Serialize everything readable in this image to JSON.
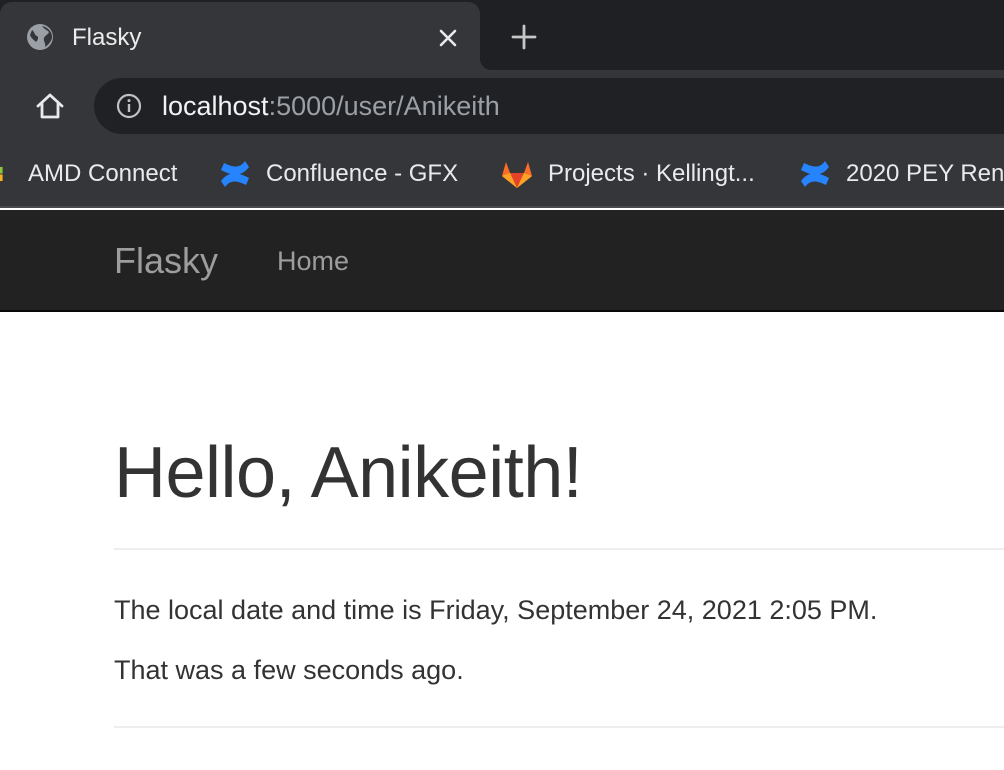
{
  "browser": {
    "tab": {
      "title": "Flasky",
      "favicon": "globe-icon",
      "close": "close-icon"
    },
    "new_tab": "plus-icon",
    "toolbar": {
      "home": "home-icon",
      "info": "info-icon"
    },
    "url": {
      "host": "localhost",
      "rest": ":5000/user/Anikeith"
    },
    "bookmarks": [
      {
        "label": "AMD Connect",
        "icon": "tiles-icon"
      },
      {
        "label": "Confluence - GFX",
        "icon": "confluence-icon"
      },
      {
        "label": "Projects · Kellingt...",
        "icon": "gitlab-icon"
      },
      {
        "label": "2020 PEY Ren",
        "icon": "confluence-icon"
      }
    ]
  },
  "navbar": {
    "brand": "Flasky",
    "links": [
      "Home"
    ]
  },
  "main": {
    "heading": "Hello, Anikeith!",
    "datetime_text": "The local date and time is Friday, September 24, 2021 2:05 PM.",
    "relative_text": "That was a few seconds ago."
  },
  "colors": {
    "tab_strip": "#1f2023",
    "toolbar": "#35363a",
    "omnibox": "#202124",
    "navbar": "#222222",
    "nav_text": "#9d9d9d",
    "body_text": "#333333",
    "confluence_blue": "#2684ff",
    "gitlab_orange": "#fc6d26"
  }
}
